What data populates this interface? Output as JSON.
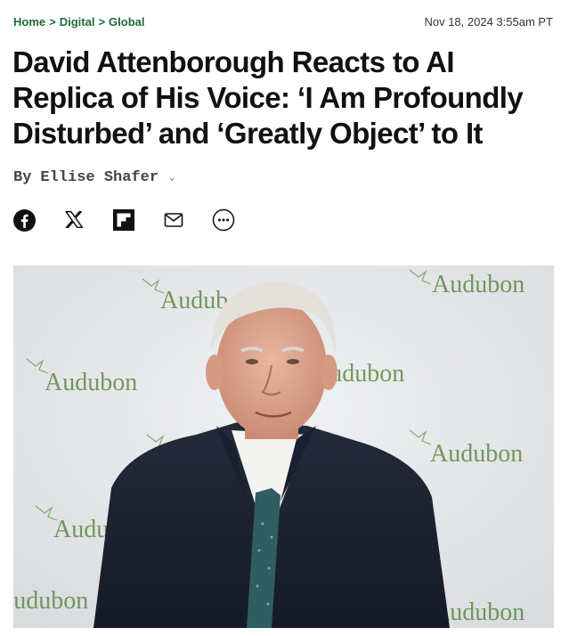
{
  "breadcrumb": {
    "items": [
      "Home",
      "Digital",
      "Global"
    ],
    "separator": ">"
  },
  "date": "Nov 18, 2024 3:55am PT",
  "headline": "David Attenborough Reacts to AI Replica of His Voice: ‘I Am Profoundly Disturbed’ and ‘Greatly Object’ to It",
  "byline": {
    "prefix": "By",
    "author": "Ellise Shafer"
  },
  "share": [
    "facebook-icon",
    "x-icon",
    "flipboard-icon",
    "email-icon",
    "more-icon"
  ],
  "hero": {
    "backdrop_text": "Audubon",
    "colors": {
      "brand_green": "#1e6b3a",
      "backdrop_text": "#5f8a45"
    }
  }
}
